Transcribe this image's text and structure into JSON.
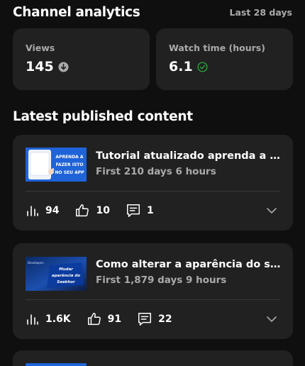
{
  "header": {
    "title": "Channel analytics",
    "period": "Last 28 days"
  },
  "stats": [
    {
      "label": "Views",
      "value": "145",
      "icon": "arrow-down-circle-icon"
    },
    {
      "label": "Watch time (hours)",
      "value": "6.1",
      "icon": "check-circle-icon",
      "icon_color": "#2ba640"
    }
  ],
  "section_title": "Latest published content",
  "videos": [
    {
      "title": "Tutorial atualizado aprenda a fazer isto no seu app",
      "subtitle": "First 210 days 6 hours",
      "thumb_text": [
        "APRENDA A",
        "FAZER ISTO",
        "NO SEU APP"
      ],
      "views": "94",
      "likes": "10",
      "comments": "1"
    },
    {
      "title": "Como alterar a aparência do seekhor",
      "subtitle": "First 1,879 days 9 hours",
      "thumb_text": [
        "Mudar",
        "aparência do",
        "Seekhor"
      ],
      "thumb_brand": "Developers",
      "views": "1.6K",
      "likes": "91",
      "comments": "22"
    }
  ],
  "colors": {
    "background": "#0f0f0f",
    "card": "#212121",
    "muted": "#aaaaaa",
    "success": "#2ba640"
  }
}
